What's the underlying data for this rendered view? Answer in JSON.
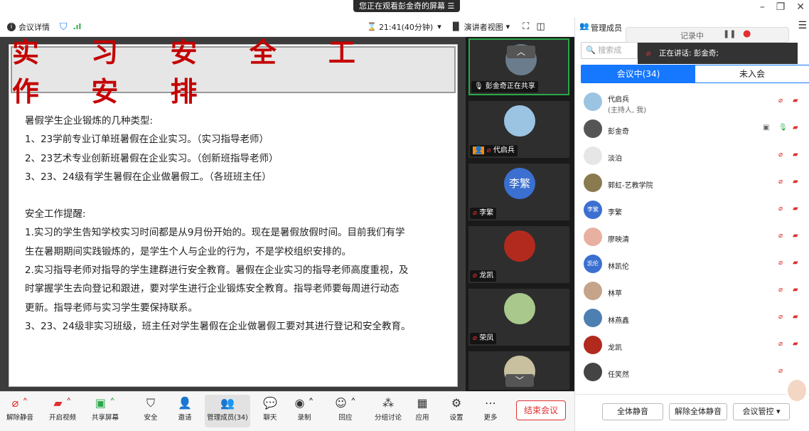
{
  "topbar": {
    "share_banner": "您正在观看彭金奇的屏幕 ☰"
  },
  "toolbar": {
    "meeting_info": "会议详情",
    "timer": "21:41(40分钟)",
    "view_mode": "演讲者视图"
  },
  "slide": {
    "title": "实 习 安 全 工 作 安 排",
    "lines": [
      "暑假学生企业锻炼的几种类型:",
      "1、23学前专业订单班暑假在企业实习。（实习指导老师）",
      "2、23艺术专业创新班暑假在企业实习。（创新班指导老师）",
      "3、23、24级有学生暑假在企业做暑假工。（各班班主任）",
      "",
      "安全工作提醒:",
      "1.实习的学生告知学校实习时间都是从9月份开始的。现在是暑假放假时间。目前我们有学",
      "生在暑期期间实践锻炼的，是学生个人与企业的行为，不是学校组织安排的。",
      "2.实习指导老师对指导的学生建群进行安全教育。暑假在企业实习的指导老师高度重视，及",
      "时掌握学生去向登记和跟进，要对学生进行企业锻炼安全教育。指导老师要每周进行动态",
      "更新。指导老师与实习学生要保持联系。",
      "3、23、24级非实习班级，班主任对学生暑假在企业做暑假工要对其进行登记和安全教育。"
    ]
  },
  "tiles": [
    {
      "label": "彭金奇正在共享"
    },
    {
      "label": "代启兵"
    },
    {
      "label": "李繁",
      "avatar_text": "李繁"
    },
    {
      "label": "龙凯"
    },
    {
      "label": "荣凤"
    }
  ],
  "side": {
    "title": "管理成员",
    "search_placeholder": "搜索成",
    "tab_in": "会议中(34)",
    "tab_out": "未入会",
    "speaking": "正在讲话:  彭金奇;",
    "recording": "记录中",
    "members": [
      {
        "name": "代启兵",
        "sub": "(主持人, 我)"
      },
      {
        "name": "彭金奇"
      },
      {
        "name": "淡泊"
      },
      {
        "name": "郭虹-艺教学院"
      },
      {
        "name": "李繁",
        "avatar_text": "李繁"
      },
      {
        "name": "廖映清"
      },
      {
        "name": "林凯伦",
        "avatar_text": "凯伦"
      },
      {
        "name": "林苹"
      },
      {
        "name": "林燕鑫"
      },
      {
        "name": "龙凯"
      },
      {
        "name": "任笑然"
      }
    ],
    "mute_all": "全体静音",
    "unmute_all": "解除全体静音",
    "control": "会议管控 ▾"
  },
  "bottom": {
    "items": [
      "解除静音",
      "开启视频",
      "共享屏幕",
      "安全",
      "邀请",
      "管理成员(34)",
      "聊天",
      "录制",
      "回应",
      "分组讨论",
      "应用",
      "设置",
      "更多"
    ],
    "end": "结束会议"
  },
  "colors": {
    "accent": "#1677ff",
    "danger": "#e03030",
    "title_red": "#c40000"
  }
}
